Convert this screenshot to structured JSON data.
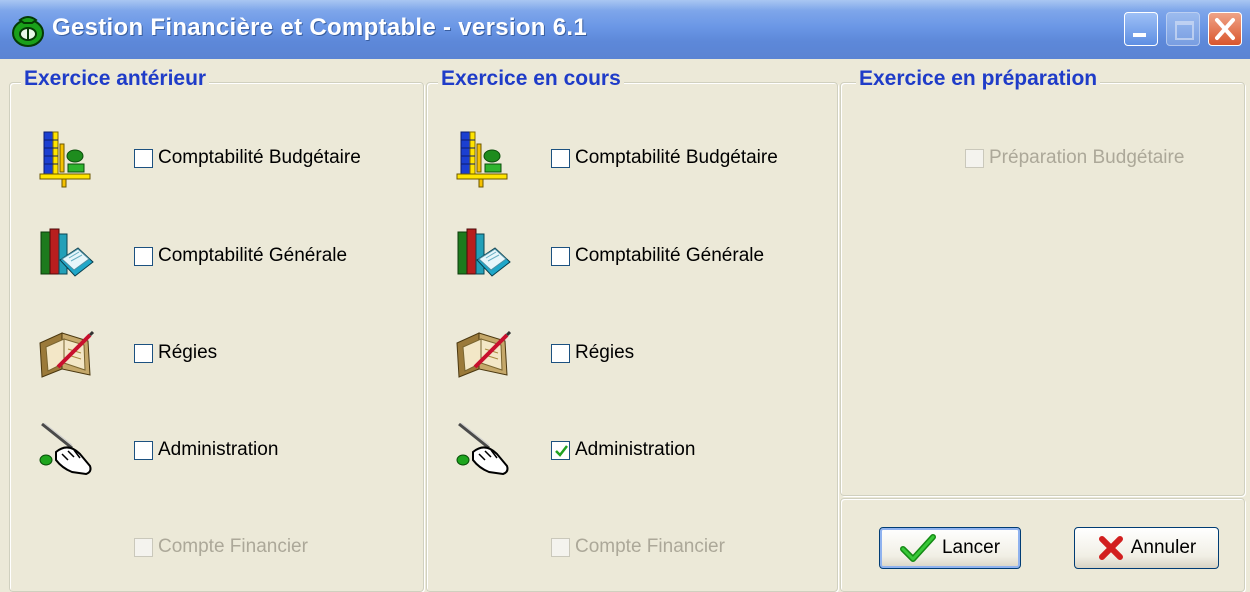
{
  "window": {
    "title": "Gestion Financière et Comptable - version 6.1",
    "controls": [
      "minimize-icon",
      "maximize-icon",
      "close-icon"
    ]
  },
  "panels": {
    "anterieur": {
      "legend": "Exercice antérieur",
      "items": [
        {
          "icon": "budget-scale-icon",
          "label": "Comptabilité Budgétaire",
          "checked": false,
          "enabled": true
        },
        {
          "icon": "books-icon",
          "label": "Comptabilité Générale",
          "checked": false,
          "enabled": true
        },
        {
          "icon": "ledger-pen-icon",
          "label": "Régies",
          "checked": false,
          "enabled": true
        },
        {
          "icon": "hand-wand-icon",
          "label": "Administration",
          "checked": false,
          "enabled": true
        },
        {
          "label": "Compte Financier",
          "checked": false,
          "enabled": false
        }
      ]
    },
    "en_cours": {
      "legend": "Exercice en cours",
      "items": [
        {
          "icon": "budget-scale-icon",
          "label": "Comptabilité Budgétaire",
          "checked": false,
          "enabled": true
        },
        {
          "icon": "books-icon",
          "label": "Comptabilité Générale",
          "checked": false,
          "enabled": true
        },
        {
          "icon": "ledger-pen-icon",
          "label": "Régies",
          "checked": false,
          "enabled": true
        },
        {
          "icon": "hand-wand-icon",
          "label": "Administration",
          "checked": true,
          "enabled": true
        },
        {
          "label": "Compte Financier",
          "checked": false,
          "enabled": false
        }
      ]
    },
    "preparation": {
      "legend": "Exercice en préparation",
      "items": [
        {
          "label": "Préparation Budgétaire",
          "checked": false,
          "enabled": false
        }
      ]
    }
  },
  "buttons": {
    "launch": {
      "label": "Lancer",
      "icon": "checkmark-icon"
    },
    "cancel": {
      "label": "Annuler",
      "icon": "x-icon"
    }
  },
  "colors": {
    "titlebar": "#6b97e6",
    "legend": "#1f3cc8",
    "dialog": "#ece9d8",
    "check": "#21a121",
    "cancel_x": "#d21f1f"
  }
}
